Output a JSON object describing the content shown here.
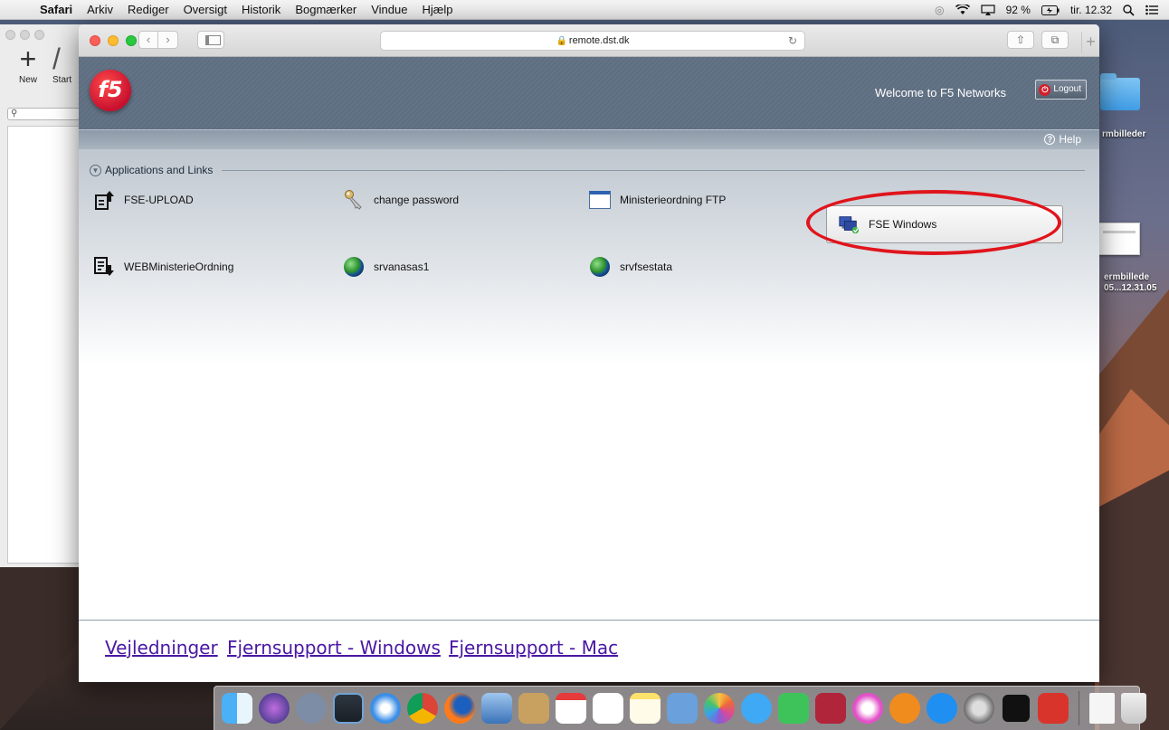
{
  "menubar": {
    "apple": "",
    "items": [
      "Safari",
      "Arkiv",
      "Rediger",
      "Oversigt",
      "Historik",
      "Bogmærker",
      "Vindue",
      "Hjælp"
    ],
    "battery": "92 %",
    "clock": "tir. 12.32"
  },
  "bgwindow": {
    "new_label": "New",
    "start_label": "Start"
  },
  "desktop": {
    "folder_label": "rmbilleder",
    "screenshot_label_1": "ermbillede",
    "screenshot_label_2": "05...12.31.05"
  },
  "browser": {
    "url": "remote.dst.dk"
  },
  "f5": {
    "logo_text": "f5",
    "welcome": "Welcome to F5 Networks",
    "logout_label": "Logout",
    "help_label": "Help",
    "section_title": "Applications and Links",
    "apps": [
      {
        "label": "FSE-UPLOAD"
      },
      {
        "label": "change password"
      },
      {
        "label": "Ministerieordning FTP"
      },
      {
        "label": "FSE Windows"
      },
      {
        "label": "WEBMinisterieOrdning"
      },
      {
        "label": "srvanasas1"
      },
      {
        "label": "srvfsestata"
      }
    ]
  },
  "footer": {
    "links": [
      "Vejledninger",
      "Fjernsupport - Windows",
      "Fjernsupport - Mac"
    ]
  },
  "colors": {
    "highlight_ring": "#e0141c",
    "link": "#4a17a3",
    "f5_red": "#c8102e"
  }
}
